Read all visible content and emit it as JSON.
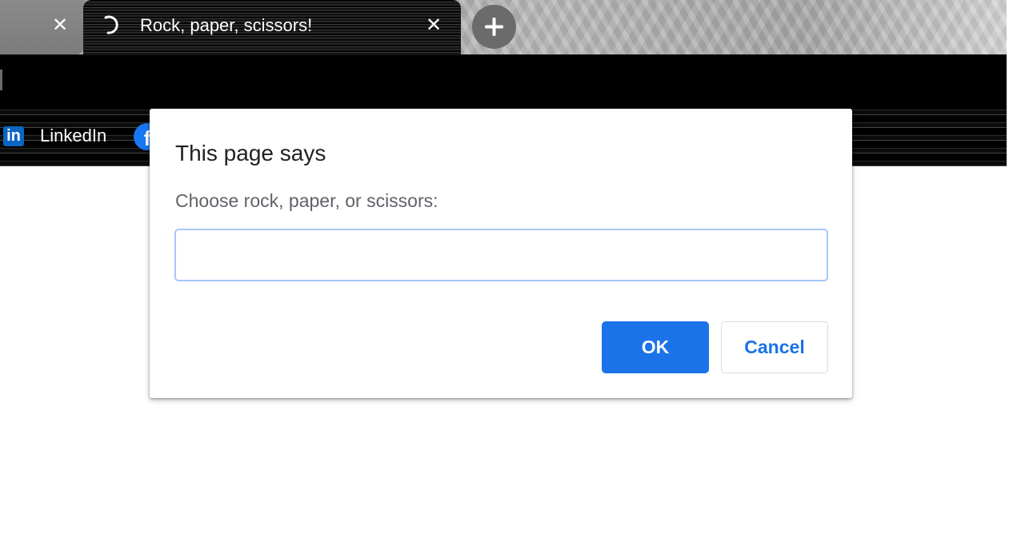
{
  "tab_strip": {
    "previous_tab": {
      "close_icon": "close-icon",
      "close_glyph": "✕"
    },
    "active_tab": {
      "title": "Rock, paper, scissors!",
      "spinner_icon": "loading-spinner-icon",
      "close_glyph": "✕"
    },
    "new_tab_icon": "plus-icon"
  },
  "bookmarks": {
    "items": [
      {
        "label": "LinkedIn",
        "icon": "linkedin-icon",
        "icon_glyph": "in",
        "color": "#0a66c2"
      },
      {
        "label": "",
        "icon": "facebook-icon",
        "icon_glyph": "f",
        "color": "#1877f2"
      }
    ]
  },
  "dialog": {
    "title": "This page says",
    "message": "Choose rock, paper, or scissors:",
    "input_value": "",
    "ok_label": "OK",
    "cancel_label": "Cancel",
    "accent_color": "#1a73e8"
  }
}
